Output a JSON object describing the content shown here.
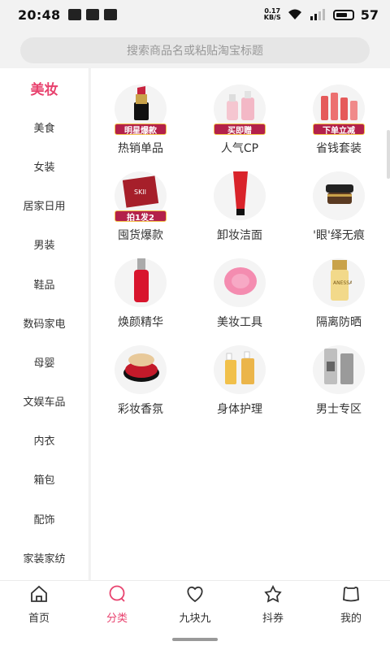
{
  "status_bar": {
    "time": "20:48",
    "net_speed": "0.17\nKB/S",
    "battery": "57"
  },
  "search": {
    "placeholder": "搜索商品名或粘贴淘宝标题"
  },
  "sidebar": {
    "items": [
      {
        "label": "美妆",
        "active": true
      },
      {
        "label": "美食"
      },
      {
        "label": "女装"
      },
      {
        "label": "居家日用"
      },
      {
        "label": "男装"
      },
      {
        "label": "鞋品"
      },
      {
        "label": "数码家电"
      },
      {
        "label": "母婴"
      },
      {
        "label": "文娱车品"
      },
      {
        "label": "内衣"
      },
      {
        "label": "箱包"
      },
      {
        "label": "配饰"
      },
      {
        "label": "家装家纺"
      }
    ]
  },
  "grid": {
    "items": [
      {
        "label": "热销单品",
        "badge": "明星爆款",
        "icon": "lipstick-icon"
      },
      {
        "label": "人气CP",
        "badge": "买即赠",
        "icon": "bottles-icon"
      },
      {
        "label": "省钱套装",
        "badge": "下单立减",
        "icon": "serum-set-icon"
      },
      {
        "label": "囤货爆款",
        "badge": "拍1发2",
        "icon": "mask-pack-icon"
      },
      {
        "label": "卸妆洁面",
        "badge": "",
        "icon": "cleanser-tube-icon"
      },
      {
        "label": "'眼'绎无痕",
        "badge": "",
        "icon": "eye-cream-jar-icon"
      },
      {
        "label": "焕颜精华",
        "badge": "",
        "icon": "essence-bottle-icon"
      },
      {
        "label": "美妆工具",
        "badge": "",
        "icon": "cleansing-brush-icon"
      },
      {
        "label": "隔离防晒",
        "badge": "",
        "icon": "sunscreen-icon"
      },
      {
        "label": "彩妆香氛",
        "badge": "",
        "icon": "cushion-compact-icon"
      },
      {
        "label": "身体护理",
        "badge": "",
        "icon": "body-care-bottles-icon"
      },
      {
        "label": "男士专区",
        "badge": "",
        "icon": "mens-bottles-icon"
      }
    ]
  },
  "bottom_nav": {
    "tabs": [
      {
        "label": "首页",
        "icon": "home-icon"
      },
      {
        "label": "分类",
        "icon": "category-icon",
        "active": true
      },
      {
        "label": "九块九",
        "icon": "heart-icon"
      },
      {
        "label": "抖券",
        "icon": "star-icon"
      },
      {
        "label": "我的",
        "icon": "profile-icon"
      }
    ]
  },
  "colors": {
    "accent": "#e8426e",
    "badge": "#b3214a"
  }
}
